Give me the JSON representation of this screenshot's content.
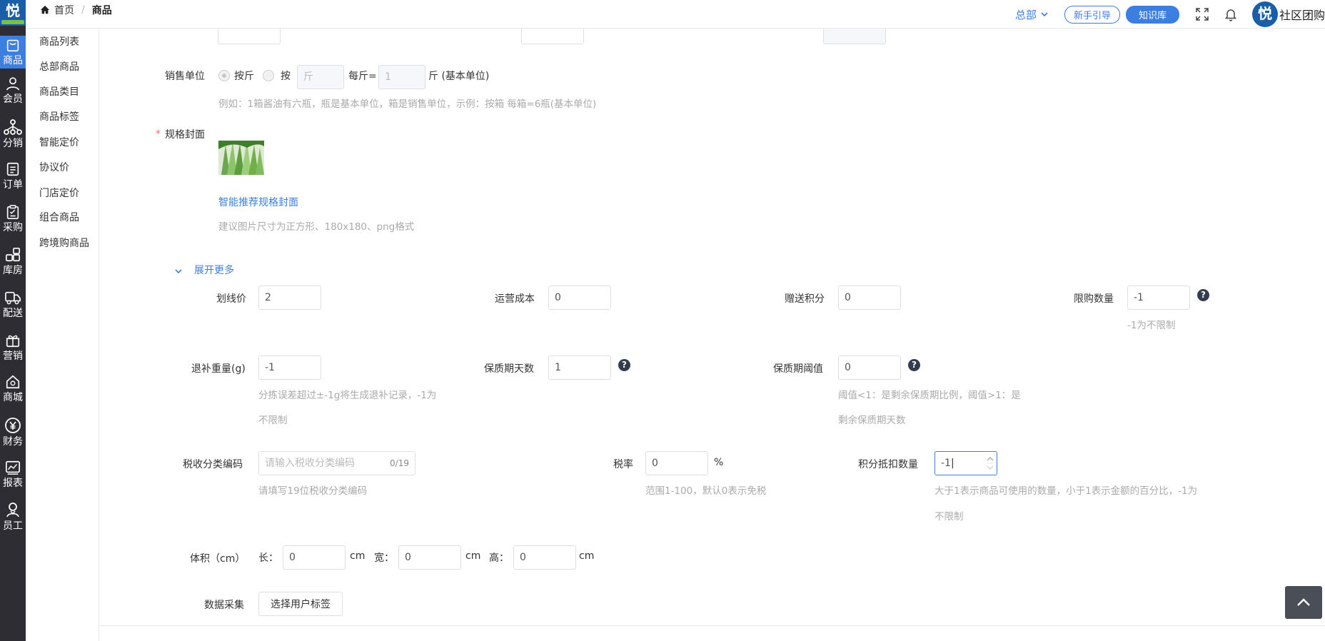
{
  "brand": {
    "logo_char": "悦"
  },
  "breadcrumb": {
    "home": "首页",
    "separator": "/",
    "current": "商品"
  },
  "header": {
    "hq_label": "总部",
    "guide_label": "新手引导",
    "kb_label": "知识库",
    "user_name": "社区团购",
    "avatar_char": "悦"
  },
  "sidebar": {
    "items": [
      {
        "label": "商品",
        "icon": "bag-icon",
        "active": true
      },
      {
        "label": "会员",
        "icon": "user-icon"
      },
      {
        "label": "分销",
        "icon": "network-icon"
      },
      {
        "label": "订单",
        "icon": "order-icon"
      },
      {
        "label": "采购",
        "icon": "clipboard-icon"
      },
      {
        "label": "库房",
        "icon": "warehouse-icon"
      },
      {
        "label": "配送",
        "icon": "truck-icon"
      },
      {
        "label": "营销",
        "icon": "gift-icon"
      },
      {
        "label": "商城",
        "icon": "shop-icon"
      },
      {
        "label": "财务",
        "icon": "yen-icon"
      },
      {
        "label": "报表",
        "icon": "chart-icon"
      },
      {
        "label": "员工",
        "icon": "staff-icon"
      }
    ]
  },
  "subnav": {
    "items": [
      "商品列表",
      "总部商品",
      "商品类目",
      "商品标签",
      "智能定价",
      "协议价",
      "门店定价",
      "组合商品",
      "跨境购商品"
    ]
  },
  "form": {
    "sale_unit": {
      "label": "销售单位",
      "opt1": "按斤",
      "opt2": "按",
      "unit_placeholder": "斤",
      "per_label": "每斤=",
      "qty_placeholder": "1",
      "base_unit": "斤 (基本单位)",
      "hint": "例如：1箱酱油有六瓶，瓶是基本单位，箱是销售单位，示例：按箱 每箱=6瓶(基本单位)"
    },
    "cover": {
      "required": "*",
      "label": "规格封面",
      "recommend_link": "智能推荐规格封面",
      "hint": "建议图片尺寸为正方形、180x180、png格式"
    },
    "expand_label": "展开更多",
    "strike_price": {
      "label": "划线价",
      "value": "2"
    },
    "op_cost": {
      "label": "运营成本",
      "value": "0"
    },
    "gift_points": {
      "label": "赠送积分",
      "value": "0"
    },
    "limit_qty": {
      "label": "限购数量",
      "value": "-1",
      "hint": "-1为不限制"
    },
    "refund_weight": {
      "label": "退补重量(g)",
      "value": "-1",
      "hint1": "分拣误差超过±-1g将生成退补记录，-1为",
      "hint2": "不限制"
    },
    "shelf_days": {
      "label": "保质期天数",
      "value": "1"
    },
    "shelf_threshold": {
      "label": "保质期阈值",
      "value": "0",
      "hint1": "阈值<1：是剩余保质期比例，阈值>1：是",
      "hint2": "剩余保质期天数"
    },
    "tax_code": {
      "label": "税收分类编码",
      "placeholder": "请输入税收分类编码",
      "counter": "0/19",
      "hint": "请填写19位税收分类编码"
    },
    "tax_rate": {
      "label": "税率",
      "value": "0",
      "unit": "%",
      "hint": "范围1-100，默认0表示免税"
    },
    "points_deduct": {
      "label": "积分抵扣数量",
      "value": "-1",
      "hint1": "大于1表示商品可使用的数量，小于1表示金额的百分比，-1为",
      "hint2": "不限制"
    },
    "volume": {
      "label": "体积（cm）",
      "len_label": "长：",
      "len_value": "0",
      "wid_label": "宽：",
      "wid_value": "0",
      "hei_label": "高：",
      "hei_value": "0",
      "unit": "cm"
    },
    "data_collect": {
      "label": "数据采集",
      "button": "选择用户标签"
    }
  }
}
